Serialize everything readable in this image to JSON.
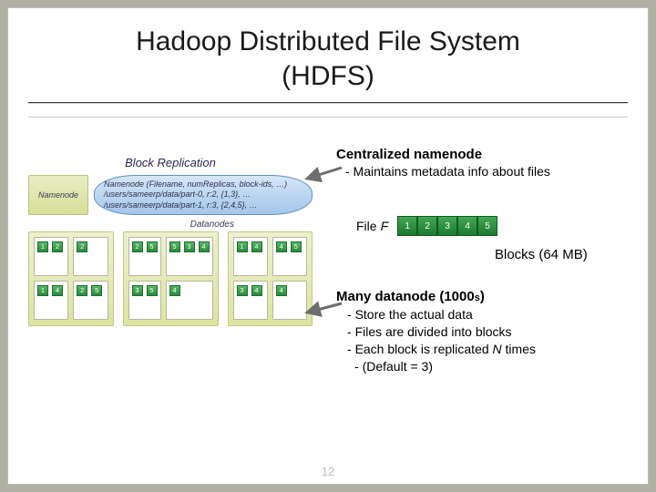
{
  "title_line1": "Hadoop Distributed File System",
  "title_line2": "(HDFS)",
  "diagram": {
    "heading": "Block Replication",
    "namenode_label": "Namenode",
    "namenode_text_line1": "Namenode (Filename, numReplicas, block-ids, …)",
    "namenode_text_line2": "/users/sameerp/data/part-0, r:2, {1,3}, …",
    "namenode_text_line3": "/users/sameerp/data/part-1, r:3, {2,4,5}, …",
    "datanodes_label": "Datanodes",
    "racks": [
      {
        "cells": [
          [
            "1",
            "2"
          ],
          [
            "2"
          ],
          [
            "1",
            "4"
          ],
          [
            "2",
            "5"
          ]
        ]
      },
      {
        "cells": [
          [
            "2",
            "5"
          ],
          [
            "5",
            "3",
            "4"
          ],
          [
            "3",
            "5"
          ],
          [
            "4"
          ]
        ]
      },
      {
        "cells": [
          [
            "1",
            "4"
          ],
          [
            "4",
            "5"
          ],
          [
            "3",
            "4"
          ],
          [
            "4"
          ]
        ]
      }
    ]
  },
  "right": {
    "namenode_heading": "Centralized namenode",
    "namenode_sub": "- Maintains metadata info about files",
    "file_label": "File",
    "file_symbol": "F",
    "file_blocks": [
      "1",
      "2",
      "3",
      "4",
      "5"
    ],
    "blocks_label": "Blocks (64 MB)",
    "datanode_heading_main": "Many datanode (1000",
    "datanode_heading_suffix": "s",
    "datanode_heading_close": ")",
    "bullets": {
      "b1": "Store the actual data",
      "b2": "Files are divided into blocks",
      "b3_pre": "Each block is replicated ",
      "b3_ital": "N",
      "b3_post": " times",
      "b4": "(Default = 3)"
    }
  },
  "page_number": "12"
}
